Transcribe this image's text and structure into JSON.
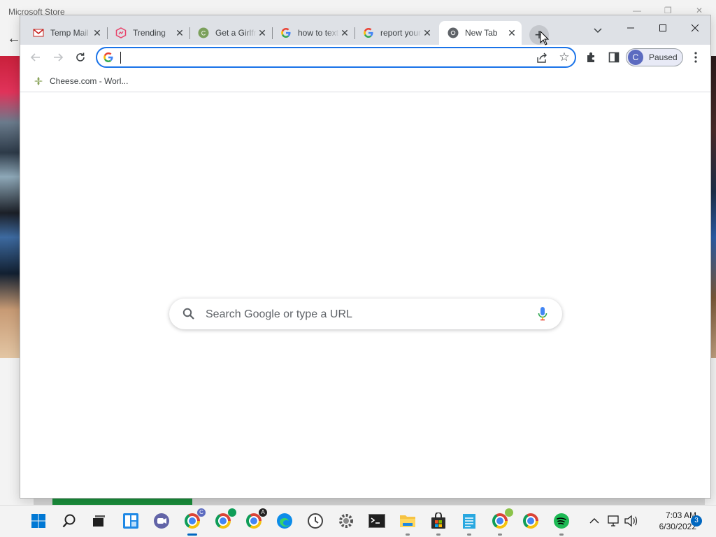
{
  "store": {
    "title": "Microsoft Store",
    "back_icon": "arrow-left-icon"
  },
  "chrome": {
    "tabs": [
      {
        "title": "Temp Mail",
        "favicon": "gmail-icon",
        "active": false
      },
      {
        "title": "Trending",
        "favicon": "trending-icon",
        "active": false
      },
      {
        "title": "Get a Girlfriend",
        "favicon": "cheese-icon",
        "active": false
      },
      {
        "title": "how to text",
        "favicon": "google-icon",
        "active": false
      },
      {
        "title": "report your",
        "favicon": "google-icon",
        "active": false
      },
      {
        "title": "New Tab",
        "favicon": "chrome-icon",
        "active": true
      }
    ],
    "newtab_label": "+",
    "omnibox": {
      "value": "",
      "placeholder": ""
    },
    "profile": {
      "initial": "C",
      "status": "Paused",
      "color": "#5c6bc0"
    },
    "bookmarks": [
      {
        "label": "Cheese.com - Worl..."
      }
    ],
    "search": {
      "placeholder": "Search Google or type a URL"
    },
    "accent": "#1a73e8"
  },
  "taskbar": {
    "apps": [
      "windows-start-icon",
      "search-icon",
      "task-view-icon",
      "widgets-icon",
      "teams-chat-icon",
      "chrome-icon",
      "chrome-icon",
      "chrome-icon",
      "edge-icon",
      "clock-app-icon",
      "settings-icon",
      "terminal-icon",
      "file-explorer-icon",
      "microsoft-store-icon",
      "notepad-icon",
      "chrome-icon",
      "chrome-icon",
      "spotify-icon"
    ],
    "time": "7:03 AM",
    "date": "6/30/2022",
    "notifications": "3"
  }
}
